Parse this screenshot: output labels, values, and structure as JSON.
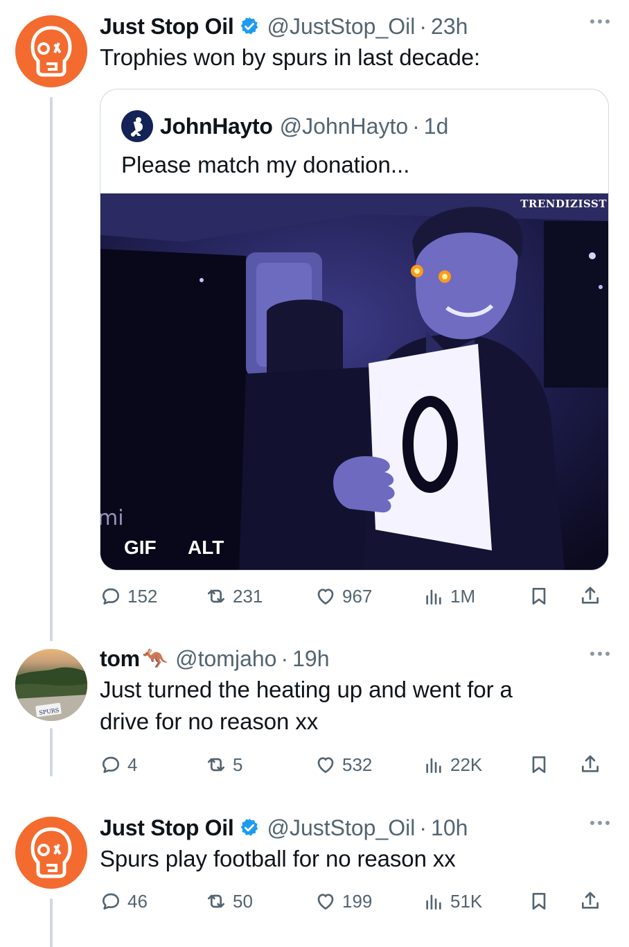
{
  "tweets": [
    {
      "author_name": "Just Stop Oil",
      "handle": "@JustStop_Oil",
      "time": "23h",
      "text": "Trophies won by spurs in last decade:",
      "quote": {
        "author_name": "JohnHayto",
        "handle": "@JohnHayto",
        "time": "1d",
        "text": "Please match my donation...",
        "media_badges": [
          "GIF",
          "ALT"
        ],
        "watermark": "TRENDIZISST",
        "sign_number": "0"
      },
      "stats": {
        "replies": "152",
        "reposts": "231",
        "likes": "967",
        "views": "1M"
      }
    },
    {
      "author_name": "tom",
      "author_emoji": "🦘",
      "handle": "@tomjaho",
      "time": "19h",
      "text_lines": [
        "Just turned the heating up and went for a",
        "drive for no reason xx"
      ],
      "avatar_label": "SPURS",
      "stats": {
        "replies": "4",
        "reposts": "5",
        "likes": "532",
        "views": "22K"
      }
    },
    {
      "author_name": "Just Stop Oil",
      "handle": "@JustStop_Oil",
      "time": "10h",
      "text": "Spurs play football for no reason xx",
      "stats": {
        "replies": "46",
        "reposts": "50",
        "likes": "199",
        "views": "51K"
      }
    }
  ],
  "separator": "·",
  "colors": {
    "brand_orange": "#f36b2f",
    "verified_blue": "#1d9bf0",
    "muted": "#536471",
    "thread_line": "#cfd9de"
  },
  "icons": [
    "reply-icon",
    "repost-icon",
    "like-icon",
    "views-icon",
    "bookmark-icon",
    "share-icon",
    "verified-icon",
    "more-icon"
  ]
}
